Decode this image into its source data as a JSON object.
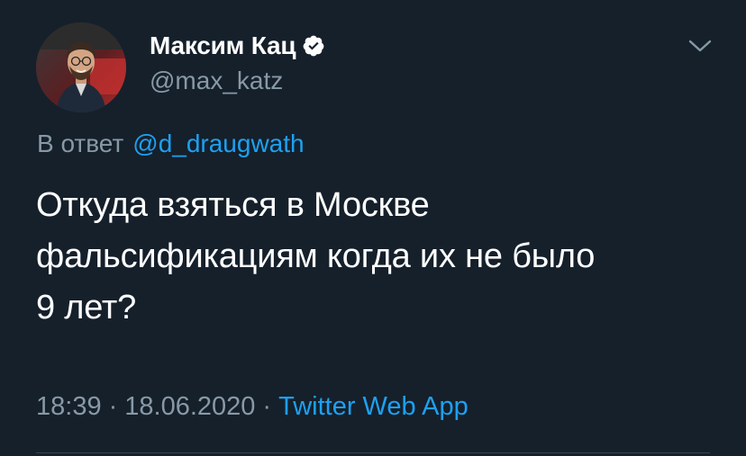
{
  "user": {
    "display_name": "Максим Кац",
    "handle": "@max_katz",
    "verified": true
  },
  "reply": {
    "label": "В ответ",
    "to_handle": "@d_draugwath"
  },
  "tweet": {
    "lines": [
      "Откуда взяться в Москве",
      "фальсификациям когда их не было",
      "9 лет?"
    ]
  },
  "meta": {
    "time": "18:39",
    "separator": "·",
    "date": "18.06.2020",
    "source": "Twitter Web App"
  },
  "icons": {
    "verified": "verified-badge-icon",
    "more": "chevron-down-icon"
  },
  "colors": {
    "background": "#15202b",
    "primary_text": "#ffffff",
    "secondary_text": "#8899a6",
    "link": "#1da1f2",
    "divider": "#38444d"
  }
}
